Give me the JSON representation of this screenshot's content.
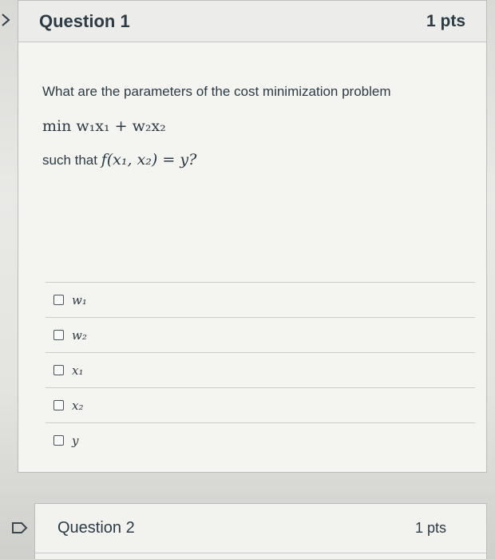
{
  "question1": {
    "title": "Question 1",
    "points": "1 pts",
    "prompt": "What are the parameters of the cost minimization problem",
    "objective": "min w₁x₁ + w₂x₂",
    "constraint_prefix": "such that",
    "constraint_math": "f(x₁, x₂) = y?",
    "answers": [
      {
        "label": "w₁",
        "checked": false
      },
      {
        "label": "w₂",
        "checked": false
      },
      {
        "label": "x₁",
        "checked": false
      },
      {
        "label": "x₂",
        "checked": false
      },
      {
        "label": "y",
        "checked": false
      }
    ]
  },
  "question2": {
    "title": "Question 2",
    "points": "1 pts"
  },
  "icons": {
    "collapse": "chevron-right-icon",
    "flag": "flag-icon"
  },
  "colors": {
    "text": "#2d3b45",
    "border": "#b9bcbd"
  }
}
